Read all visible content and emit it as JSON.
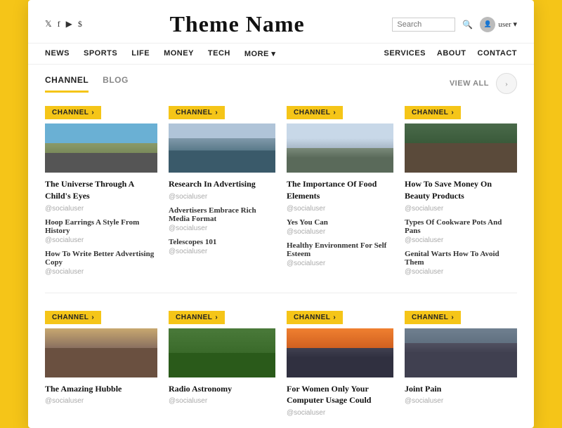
{
  "site": {
    "title": "Theme Name",
    "social_icons": [
      "𝕏",
      "f",
      "▶",
      "$"
    ],
    "search_placeholder": "Search",
    "user_label": "user ▾"
  },
  "nav": {
    "left_items": [
      "NEWS",
      "SPORTS",
      "LIFE",
      "MONEY",
      "TECH",
      "MORE ▾"
    ],
    "right_items": [
      "SERVICES",
      "ABOUT",
      "CONTACT"
    ]
  },
  "tabs": {
    "items": [
      "CHANNEL",
      "BLOG"
    ],
    "active": 0,
    "view_all": "VIEW ALL"
  },
  "channel_badge": "CHANNEL",
  "channel_arrow": "›",
  "rows": [
    {
      "columns": [
        {
          "img_class": "img-road",
          "main_title": "The Universe Through A Child's Eyes",
          "main_author": "@socialuser",
          "subs": [
            {
              "title": "Hoop Earrings A Style From History",
              "author": "@socialuser"
            },
            {
              "title": "How To Write Better Advertising Copy",
              "author": "@socialuser"
            }
          ]
        },
        {
          "img_class": "img-bridge",
          "main_title": "Research In Advertising",
          "main_author": "@socialuser",
          "subs": [
            {
              "title": "Advertisers Embrace Rich Media Format",
              "author": "@socialuser"
            },
            {
              "title": "Telescopes 101",
              "author": "@socialuser"
            }
          ]
        },
        {
          "img_class": "img-van",
          "main_title": "The Importance Of Food Elements",
          "main_author": "@socialuser",
          "subs": [
            {
              "title": "Yes You Can",
              "author": "@socialuser"
            },
            {
              "title": "Healthy Environment For Self Esteem",
              "author": "@socialuser"
            }
          ]
        },
        {
          "img_class": "img-house",
          "main_title": "How To Save Money On Beauty Products",
          "main_author": "@socialuser",
          "subs": [
            {
              "title": "Types Of Cookware Pots And Pans",
              "author": "@socialuser"
            },
            {
              "title": "Genital Warts How To Avoid Them",
              "author": "@socialuser"
            }
          ]
        }
      ]
    },
    {
      "columns": [
        {
          "img_class": "img-food",
          "main_title": "The Amazing Hubble",
          "main_author": "@socialuser",
          "subs": []
        },
        {
          "img_class": "img-flower",
          "main_title": "Radio Astronomy",
          "main_author": "@socialuser",
          "subs": []
        },
        {
          "img_class": "img-sunset",
          "main_title": "For Women Only Your Computer Usage Could",
          "main_author": "@socialuser",
          "subs": []
        },
        {
          "img_class": "img-street",
          "main_title": "Joint Pain",
          "main_author": "@socialuser",
          "subs": []
        }
      ]
    }
  ]
}
